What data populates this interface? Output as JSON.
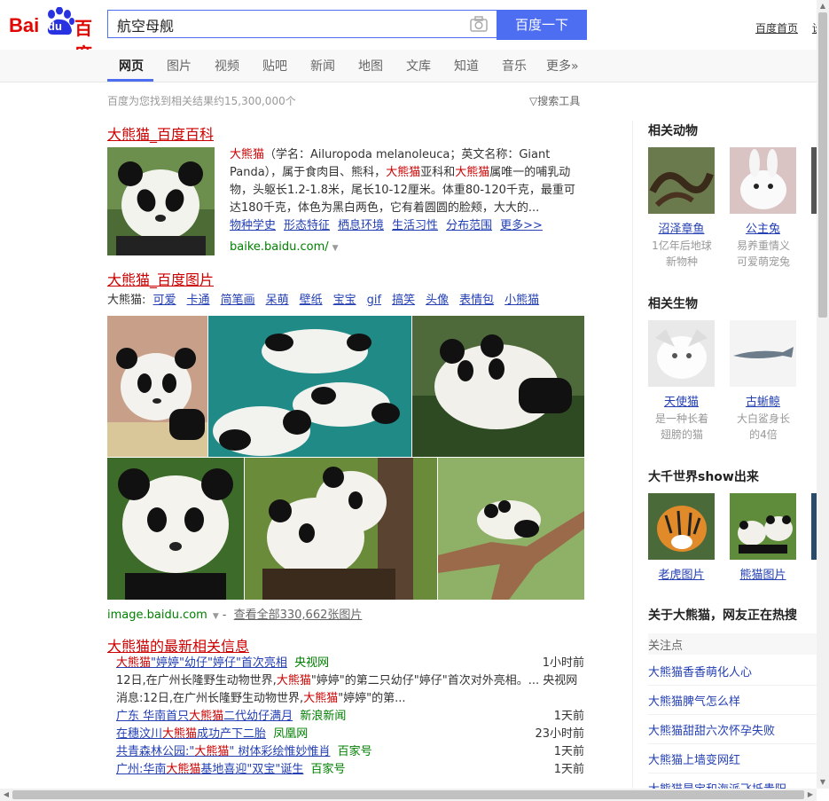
{
  "logo": {
    "latin1": "Bai",
    "du": "du",
    "cn": "百度"
  },
  "search": {
    "query": "航空母舰",
    "button": "百度一下"
  },
  "top_links": [
    "百度首页",
    "设"
  ],
  "tabs": [
    "网页",
    "图片",
    "视频",
    "贴吧",
    "新闻",
    "地图",
    "文库",
    "知道",
    "音乐",
    "更多»"
  ],
  "stats": "百度为您找到相关结果约15,300,000个",
  "tools": "搜索工具",
  "baike": {
    "title": "大熊猫_百度百科",
    "desc_kw1": "大熊猫",
    "desc_a": "（学名：Ailuropoda melanoleuca；英文名称：Giant Panda），属于食肉目、熊科，",
    "desc_kw2": "大熊猫",
    "desc_b": "亚科和",
    "desc_kw3": "大熊猫",
    "desc_c": "属唯一的哺乳动物，头躯长1.2-1.8米，尾长10-12厘米。体重80-120千克，最重可达180千克，体色为黑白两色，它有着圆圆的脸颊，大大的...",
    "links": [
      "物种学史",
      "形态特征",
      "栖息环境",
      "生活习性",
      "分布范围",
      "更多>>"
    ],
    "url": "baike.baidu.com/"
  },
  "images": {
    "title": "大熊猫_百度图片",
    "prefix": "大熊猫:",
    "tags": [
      "可爱",
      "卡通",
      "简笔画",
      "呆萌",
      "壁纸",
      "宝宝",
      "gif",
      "搞笑",
      "头像",
      "表情包",
      "小熊猫"
    ],
    "url": "image.baidu.com",
    "sep": "-",
    "view_all": "查看全部330,662张图片"
  },
  "news": {
    "title_kw": "大熊猫",
    "title_rest": "的最新相关信息",
    "top": {
      "pre": "",
      "kw": "大熊猫",
      "post": "\"婷婷\"幼仔\"婷仔\"首次亮相",
      "source": "央视网",
      "time": "1小时前"
    },
    "snippet_a": "12日,在广州长隆野生动物世界,",
    "snippet_kw1": "大熊猫",
    "snippet_b": "\"婷婷\"的第二只幼仔\"婷仔\"首次对外亮相。... 央视网消息:12日,在广州长隆野生动物世界,",
    "snippet_kw2": "大熊猫",
    "snippet_c": "\"婷婷\"的第...",
    "items": [
      {
        "pre": "广东 华南首只",
        "kw": "大熊猫",
        "post": "二代幼仔满月",
        "source": "新浪新闻",
        "time": "1天前"
      },
      {
        "pre": "在穗汶川",
        "kw": "大熊猫",
        "post": "成功产下二胎",
        "source": "凤凰网",
        "time": "23小时前"
      },
      {
        "pre": "共青森林公园:\"",
        "kw": "大熊猫",
        "post": "\" 树体彩绘惟妙惟肖",
        "source": "百家号",
        "time": "1天前"
      },
      {
        "pre": "广州:华南",
        "kw": "大熊猫",
        "post": "基地喜迎\"双宝\"诞生",
        "source": "百家号",
        "time": "1天前"
      }
    ]
  },
  "right": {
    "animals": {
      "heading": "相关动物",
      "items": [
        {
          "name": "沼泽章鱼",
          "sub1": "1亿年后地球",
          "sub2": "新物种"
        },
        {
          "name": "公主兔",
          "sub1": "易养重情义",
          "sub2": "可爱萌宠兔"
        }
      ]
    },
    "creatures": {
      "heading": "相关生物",
      "items": [
        {
          "name": "天使猫",
          "sub1": "是一种长着",
          "sub2": "翅膀的猫"
        },
        {
          "name": "古蜥鲸",
          "sub1": "大白鲨身长",
          "sub2": "的4倍"
        }
      ]
    },
    "show": {
      "heading": "大千世界show出来",
      "items": [
        {
          "name": "老虎图片"
        },
        {
          "name": "熊猫图片"
        }
      ]
    },
    "hot": {
      "heading": "关于大熊猫，网友正在热搜",
      "sub": "关注点",
      "items": [
        "大熊猫香香萌化人心",
        "大熊猫脾气怎么样",
        "大熊猫甜甜六次怀孕失败",
        "大熊猫上墙变网红",
        "大熊猫是宝和海派飞抵贵阳"
      ]
    }
  }
}
